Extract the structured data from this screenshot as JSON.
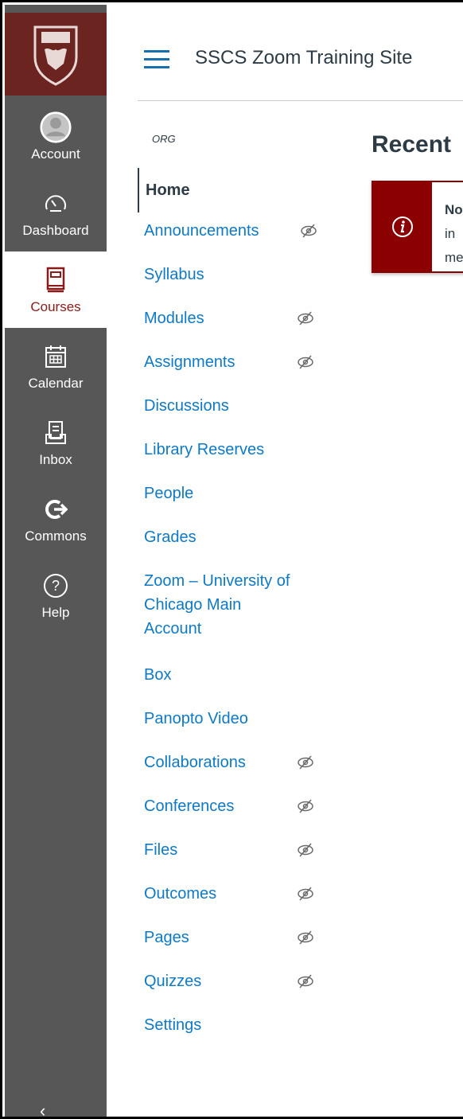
{
  "global_nav": {
    "items": [
      {
        "label": "Account",
        "icon": "avatar-icon"
      },
      {
        "label": "Dashboard",
        "icon": "dashboard-icon"
      },
      {
        "label": "Courses",
        "icon": "courses-icon",
        "active": true
      },
      {
        "label": "Calendar",
        "icon": "calendar-icon"
      },
      {
        "label": "Inbox",
        "icon": "inbox-icon"
      },
      {
        "label": "Commons",
        "icon": "commons-icon"
      },
      {
        "label": "Help",
        "icon": "help-icon"
      }
    ],
    "colors": {
      "background": "#575757",
      "logo": "#6b2420",
      "active_text": "#8a1b1b"
    }
  },
  "header": {
    "title": "SSCS Zoom Training Site"
  },
  "course_nav": {
    "section_label": "ORG",
    "items": [
      {
        "label": "Home",
        "active": true,
        "hidden": false
      },
      {
        "label": "Announcements",
        "hidden": true
      },
      {
        "label": "Syllabus",
        "hidden": false
      },
      {
        "label": "Modules",
        "hidden": true
      },
      {
        "label": "Assignments",
        "hidden": true
      },
      {
        "label": "Discussions",
        "hidden": false
      },
      {
        "label": "Library Reserves",
        "hidden": false
      },
      {
        "label": "People",
        "hidden": false
      },
      {
        "label": "Grades",
        "hidden": false
      },
      {
        "label": "Zoom – University of",
        "hidden": false
      },
      {
        "label": "Chicago Main",
        "hidden": false
      },
      {
        "label": "Account",
        "hidden": false
      },
      {
        "label": "Box",
        "hidden": false
      },
      {
        "label": "Panopto Video",
        "hidden": false
      },
      {
        "label": "Collaborations",
        "hidden": true
      },
      {
        "label": "Conferences",
        "hidden": true
      },
      {
        "label": "Files",
        "hidden": true
      },
      {
        "label": "Outcomes",
        "hidden": true
      },
      {
        "label": "Pages",
        "hidden": true
      },
      {
        "label": "Quizzes",
        "hidden": true
      },
      {
        "label": "Settings",
        "hidden": false
      }
    ],
    "colors": {
      "link": "#0e79c4"
    }
  },
  "main": {
    "title": "Recent",
    "alert": {
      "line1": "No",
      "line2": "in",
      "line3": "me",
      "color": "#8b0000"
    }
  }
}
